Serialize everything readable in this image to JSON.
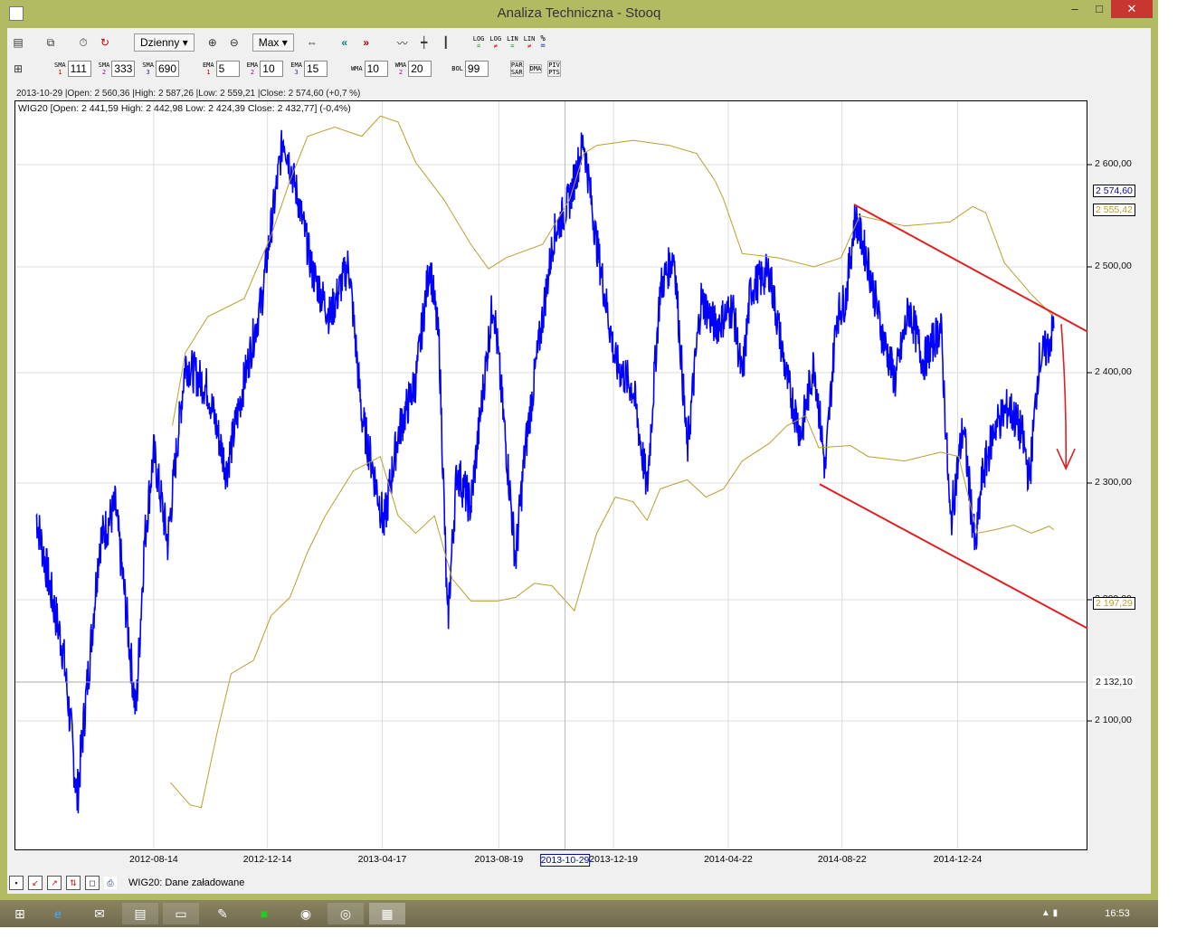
{
  "window": {
    "title": "Analiza Techniczna - Stooq",
    "minimize": "–",
    "maximize": "□",
    "close": "✕"
  },
  "toolbar1": {
    "period": "Dzienny",
    "range": "Max",
    "log1": "LOG",
    "log2": "LOG",
    "lin1": "LIN",
    "lin2": "LIN",
    "pct": "%",
    "eq": "=",
    "neq": "≠"
  },
  "toolbar2": {
    "indicators": [
      {
        "name": "SMA",
        "n": "1",
        "value": "111"
      },
      {
        "name": "SMA",
        "n": "2",
        "value": "333"
      },
      {
        "name": "SMA",
        "n": "3",
        "value": "690"
      },
      {
        "name": "EMA",
        "n": "1",
        "value": "5"
      },
      {
        "name": "EMA",
        "n": "2",
        "value": "10"
      },
      {
        "name": "EMA",
        "n": "3",
        "value": "15"
      },
      {
        "name": "WMA",
        "n": "",
        "value": "10"
      },
      {
        "name": "WMA",
        "n": "2",
        "value": "20"
      },
      {
        "name": "BOL",
        "n": "",
        "value": "99"
      }
    ],
    "par": "PAR",
    "sar": "SAR",
    "dma": "DMA",
    "piv": "PIV",
    "pts": "PTS"
  },
  "cursor_info": "2013-10-29 |Open: 2 560,36 |High: 2 587,26 |Low: 2 559,21 |Close: 2 574,60 (+0,7 %)",
  "status": {
    "message": "WIG20: Dane załadowane"
  },
  "taskbar": {
    "time": "16:53"
  },
  "colors": {
    "price": "#0000ff",
    "bands": "#b8a030",
    "trend": "#e02020"
  },
  "chart_data": {
    "type": "line",
    "legend": "WIG20 [Open: 2 441,59  High: 2 442,98  Low: 2 424,39  Close: 2 432,77] (-0,4%)",
    "y_scale": "log",
    "ylim": [
      2000,
      2650
    ],
    "y_ticks": [
      "2 600,00",
      "2 500,00",
      "2 400,00",
      "2 300,00",
      "2 200,00",
      "2 100,00"
    ],
    "y_tick_values": [
      2600,
      2500,
      2400,
      2300,
      2200,
      2100
    ],
    "x_ticks": [
      "2012-08-14",
      "2012-12-14",
      "2013-04-17",
      "2013-08-19",
      "2013-10-29",
      "2013-12-19",
      "2014-04-22",
      "2014-08-22",
      "2014-12-24"
    ],
    "x_tick_days": [
      126,
      248,
      371,
      496,
      567,
      619,
      742,
      864,
      988
    ],
    "x_unit": "days since start (~2012-04-10)",
    "highlighted_x": "2013-10-29",
    "markers": [
      {
        "label": "2 574,60",
        "value": 2574.6,
        "kind": "price"
      },
      {
        "label": "2 555,42",
        "value": 2555.42,
        "kind": "band"
      },
      {
        "label": "2 197,29",
        "value": 2197.29,
        "kind": "band"
      },
      {
        "label": "2 132,10",
        "value": 2132.1,
        "kind": "cursor"
      }
    ],
    "series": [
      {
        "name": "WIG20",
        "points": [
          [
            0,
            2272
          ],
          [
            15,
            2210
          ],
          [
            29,
            2157
          ],
          [
            44,
            2041
          ],
          [
            58,
            2157
          ],
          [
            68,
            2249
          ],
          [
            85,
            2280
          ],
          [
            97,
            2187
          ],
          [
            107,
            2105
          ],
          [
            116,
            2249
          ],
          [
            126,
            2328
          ],
          [
            141,
            2249
          ],
          [
            160,
            2410
          ],
          [
            184,
            2385
          ],
          [
            204,
            2311
          ],
          [
            223,
            2393
          ],
          [
            242,
            2470
          ],
          [
            252,
            2540
          ],
          [
            265,
            2628
          ],
          [
            281,
            2566
          ],
          [
            296,
            2496
          ],
          [
            315,
            2453
          ],
          [
            335,
            2504
          ],
          [
            349,
            2361
          ],
          [
            373,
            2264
          ],
          [
            388,
            2344
          ],
          [
            407,
            2393
          ],
          [
            422,
            2504
          ],
          [
            432,
            2427
          ],
          [
            441,
            2179
          ],
          [
            451,
            2311
          ],
          [
            466,
            2280
          ],
          [
            490,
            2470
          ],
          [
            500,
            2369
          ],
          [
            514,
            2234
          ],
          [
            524,
            2328
          ],
          [
            543,
            2453
          ],
          [
            555,
            2531
          ],
          [
            572,
            2566
          ],
          [
            587,
            2624
          ],
          [
            601,
            2522
          ],
          [
            621,
            2410
          ],
          [
            640,
            2385
          ],
          [
            655,
            2295
          ],
          [
            669,
            2479
          ],
          [
            684,
            2513
          ],
          [
            698,
            2328
          ],
          [
            713,
            2470
          ],
          [
            728,
            2444
          ],
          [
            747,
            2462
          ],
          [
            757,
            2393
          ],
          [
            766,
            2479
          ],
          [
            786,
            2496
          ],
          [
            805,
            2393
          ],
          [
            820,
            2344
          ],
          [
            834,
            2410
          ],
          [
            846,
            2311
          ],
          [
            858,
            2453
          ],
          [
            868,
            2470
          ],
          [
            878,
            2549
          ],
          [
            892,
            2504
          ],
          [
            907,
            2436
          ],
          [
            921,
            2393
          ],
          [
            936,
            2462
          ],
          [
            951,
            2410
          ],
          [
            970,
            2444
          ],
          [
            980,
            2264
          ],
          [
            994,
            2352
          ],
          [
            1007,
            2241
          ],
          [
            1014,
            2303
          ],
          [
            1028,
            2352
          ],
          [
            1043,
            2369
          ],
          [
            1057,
            2344
          ],
          [
            1065,
            2303
          ],
          [
            1075,
            2410
          ],
          [
            1086,
            2427
          ],
          [
            1091,
            2444
          ]
        ]
      },
      {
        "name": "BOL upper",
        "points": [
          [
            146,
            2352
          ],
          [
            160,
            2419
          ],
          [
            184,
            2453
          ],
          [
            223,
            2470
          ],
          [
            252,
            2531
          ],
          [
            272,
            2584
          ],
          [
            291,
            2628
          ],
          [
            320,
            2637
          ],
          [
            349,
            2628
          ],
          [
            369,
            2648
          ],
          [
            388,
            2642
          ],
          [
            407,
            2602
          ],
          [
            437,
            2566
          ],
          [
            466,
            2522
          ],
          [
            485,
            2498
          ],
          [
            504,
            2509
          ],
          [
            543,
            2522
          ],
          [
            572,
            2566
          ],
          [
            587,
            2611
          ],
          [
            601,
            2619
          ],
          [
            640,
            2624
          ],
          [
            679,
            2619
          ],
          [
            708,
            2611
          ],
          [
            728,
            2584
          ],
          [
            737,
            2566
          ],
          [
            757,
            2513
          ],
          [
            795,
            2509
          ],
          [
            834,
            2500
          ],
          [
            863,
            2509
          ],
          [
            883,
            2550
          ],
          [
            931,
            2540
          ],
          [
            980,
            2544
          ],
          [
            1004,
            2559
          ],
          [
            1018,
            2553
          ],
          [
            1038,
            2504
          ],
          [
            1067,
            2474
          ],
          [
            1091,
            2453
          ]
        ]
      },
      {
        "name": "BOL lower",
        "points": [
          [
            144,
            2053
          ],
          [
            165,
            2036
          ],
          [
            177,
            2034
          ],
          [
            194,
            2091
          ],
          [
            209,
            2139
          ],
          [
            233,
            2150
          ],
          [
            252,
            2187
          ],
          [
            272,
            2202
          ],
          [
            291,
            2241
          ],
          [
            310,
            2272
          ],
          [
            340,
            2311
          ],
          [
            369,
            2324
          ],
          [
            388,
            2272
          ],
          [
            407,
            2257
          ],
          [
            427,
            2272
          ],
          [
            446,
            2218
          ],
          [
            466,
            2199
          ],
          [
            495,
            2199
          ],
          [
            514,
            2202
          ],
          [
            534,
            2214
          ],
          [
            553,
            2212
          ],
          [
            577,
            2191
          ],
          [
            601,
            2257
          ],
          [
            621,
            2288
          ],
          [
            640,
            2284
          ],
          [
            655,
            2268
          ],
          [
            669,
            2295
          ],
          [
            698,
            2303
          ],
          [
            718,
            2288
          ],
          [
            737,
            2295
          ],
          [
            757,
            2320
          ],
          [
            786,
            2336
          ],
          [
            805,
            2352
          ],
          [
            825,
            2361
          ],
          [
            839,
            2332
          ],
          [
            873,
            2334
          ],
          [
            892,
            2324
          ],
          [
            931,
            2320
          ],
          [
            970,
            2328
          ],
          [
            989,
            2324
          ],
          [
            1009,
            2257
          ],
          [
            1028,
            2260
          ],
          [
            1048,
            2264
          ],
          [
            1067,
            2257
          ],
          [
            1086,
            2263
          ],
          [
            1091,
            2260
          ]
        ]
      }
    ],
    "trendlines": [
      {
        "name": "upper-channel",
        "from": [
          877,
          2561
        ],
        "to": [
          1133,
          2436
        ]
      },
      {
        "name": "lower-channel",
        "from": [
          840,
          2299
        ],
        "to": [
          1133,
          2174
        ]
      }
    ],
    "arrow": {
      "from": [
        1099,
        2446
      ],
      "to": [
        1104,
        2313
      ]
    }
  }
}
